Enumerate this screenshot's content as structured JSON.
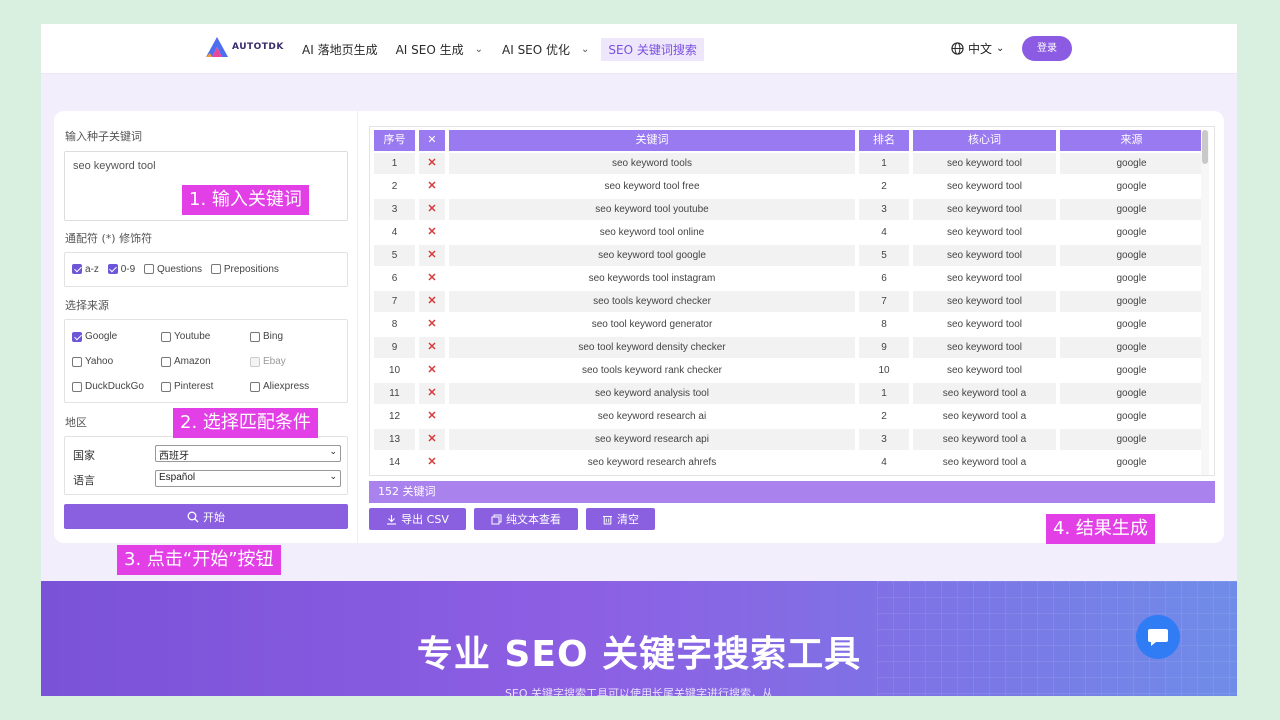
{
  "header": {
    "logo_text": "AUTOTDK",
    "nav": [
      {
        "label": "AI 落地页生成",
        "has_dropdown": false,
        "active": false
      },
      {
        "label": "AI SEO 生成",
        "has_dropdown": true,
        "active": false
      },
      {
        "label": "AI SEO 优化",
        "has_dropdown": true,
        "active": false
      },
      {
        "label": "SEO 关键词搜索",
        "has_dropdown": false,
        "active": true
      }
    ],
    "language": "中文",
    "login_label": "登录"
  },
  "form": {
    "seed_label": "输入种子关键词",
    "seed_value": "seo keyword tool",
    "wildcard_label": "通配符 (*) 修饰符",
    "wildcards": [
      {
        "label": "a-z",
        "checked": true
      },
      {
        "label": "0-9",
        "checked": true
      },
      {
        "label": "Questions",
        "checked": false
      },
      {
        "label": "Prepositions",
        "checked": false
      }
    ],
    "source_label": "选择来源",
    "sources": [
      {
        "label": "Google",
        "checked": true,
        "disabled": false
      },
      {
        "label": "Youtube",
        "checked": false,
        "disabled": false
      },
      {
        "label": "Bing",
        "checked": false,
        "disabled": false
      },
      {
        "label": "Yahoo",
        "checked": false,
        "disabled": false
      },
      {
        "label": "Amazon",
        "checked": false,
        "disabled": false
      },
      {
        "label": "Ebay",
        "checked": false,
        "disabled": true
      },
      {
        "label": "DuckDuckGo",
        "checked": false,
        "disabled": false
      },
      {
        "label": "Pinterest",
        "checked": false,
        "disabled": false
      },
      {
        "label": "Aliexpress",
        "checked": false,
        "disabled": false
      }
    ],
    "region_label": "地区",
    "country_label": "国家",
    "country_value": "西班牙",
    "language_label": "语言",
    "language_value": "Español",
    "start_label": "开始"
  },
  "table": {
    "headers": [
      "序号",
      "✕",
      "关键词",
      "排名",
      "核心词",
      "来源"
    ],
    "rows": [
      {
        "n": "1",
        "kw": "seo keyword tools",
        "rank": "1",
        "core": "seo keyword tool",
        "src": "google"
      },
      {
        "n": "2",
        "kw": "seo keyword tool free",
        "rank": "2",
        "core": "seo keyword tool",
        "src": "google"
      },
      {
        "n": "3",
        "kw": "seo keyword tool youtube",
        "rank": "3",
        "core": "seo keyword tool",
        "src": "google"
      },
      {
        "n": "4",
        "kw": "seo keyword tool online",
        "rank": "4",
        "core": "seo keyword tool",
        "src": "google"
      },
      {
        "n": "5",
        "kw": "seo keyword tool google",
        "rank": "5",
        "core": "seo keyword tool",
        "src": "google"
      },
      {
        "n": "6",
        "kw": "seo keywords tool instagram",
        "rank": "6",
        "core": "seo keyword tool",
        "src": "google"
      },
      {
        "n": "7",
        "kw": "seo tools keyword checker",
        "rank": "7",
        "core": "seo keyword tool",
        "src": "google"
      },
      {
        "n": "8",
        "kw": "seo tool keyword generator",
        "rank": "8",
        "core": "seo keyword tool",
        "src": "google"
      },
      {
        "n": "9",
        "kw": "seo tool keyword density checker",
        "rank": "9",
        "core": "seo keyword tool",
        "src": "google"
      },
      {
        "n": "10",
        "kw": "seo tools keyword rank checker",
        "rank": "10",
        "core": "seo keyword tool",
        "src": "google"
      },
      {
        "n": "11",
        "kw": "seo keyword analysis tool",
        "rank": "1",
        "core": "seo keyword tool a",
        "src": "google"
      },
      {
        "n": "12",
        "kw": "seo keyword research ai",
        "rank": "2",
        "core": "seo keyword tool a",
        "src": "google"
      },
      {
        "n": "13",
        "kw": "seo keyword research api",
        "rank": "3",
        "core": "seo keyword tool a",
        "src": "google"
      },
      {
        "n": "14",
        "kw": "seo keyword research ahrefs",
        "rank": "4",
        "core": "seo keyword tool a",
        "src": "google"
      }
    ],
    "delete_mark": "✕",
    "count_text": "152 关键词"
  },
  "actions": {
    "export_label": "导出 CSV",
    "plaintext_label": "纯文本查看",
    "clear_label": "清空"
  },
  "annotations": {
    "step1": "1. 输入关键词",
    "step2": "2. 选择匹配条件",
    "step3": "3. 点击“开始”按钮",
    "step4": "4. 结果生成"
  },
  "hero": {
    "title": "专业 SEO 关键字搜索工具",
    "subtitle": "SEO 关键字搜索工具可以使用长尾关键字进行搜索，从"
  },
  "colors": {
    "accent": "#8a5fe0",
    "table_header": "#9a7af0",
    "annotation": "#e23fe6",
    "delete_red": "#d63a3a",
    "chat": "#2f7cf5"
  }
}
